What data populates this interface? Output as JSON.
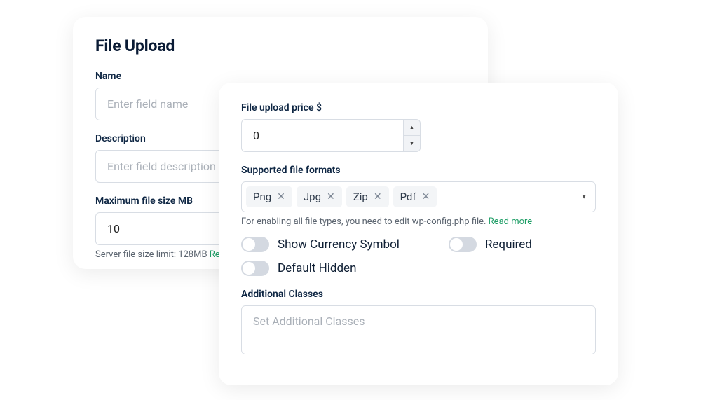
{
  "back": {
    "title": "File Upload",
    "name_label": "Name",
    "name_placeholder": "Enter field name",
    "desc_label": "Description",
    "desc_placeholder": "Enter field description",
    "max_label": "Maximum file size MB",
    "max_value": "10",
    "server_note_prefix": "Server file size limit: 128MB ",
    "server_note_link": "Read more"
  },
  "front": {
    "price_label": "File upload price $",
    "price_value": "0",
    "formats_label": "Supported file formats",
    "formats": [
      "Png",
      "Jpg",
      "Zip",
      "Pdf"
    ],
    "formats_note_prefix": "For enabling all file types, you need to edit wp-config.php file. ",
    "formats_note_link": "Read more",
    "toggle_currency": "Show Currency Symbol",
    "toggle_required": "Required",
    "toggle_hidden": "Default Hidden",
    "classes_label": "Additional Classes",
    "classes_placeholder": "Set Additional Classes"
  }
}
